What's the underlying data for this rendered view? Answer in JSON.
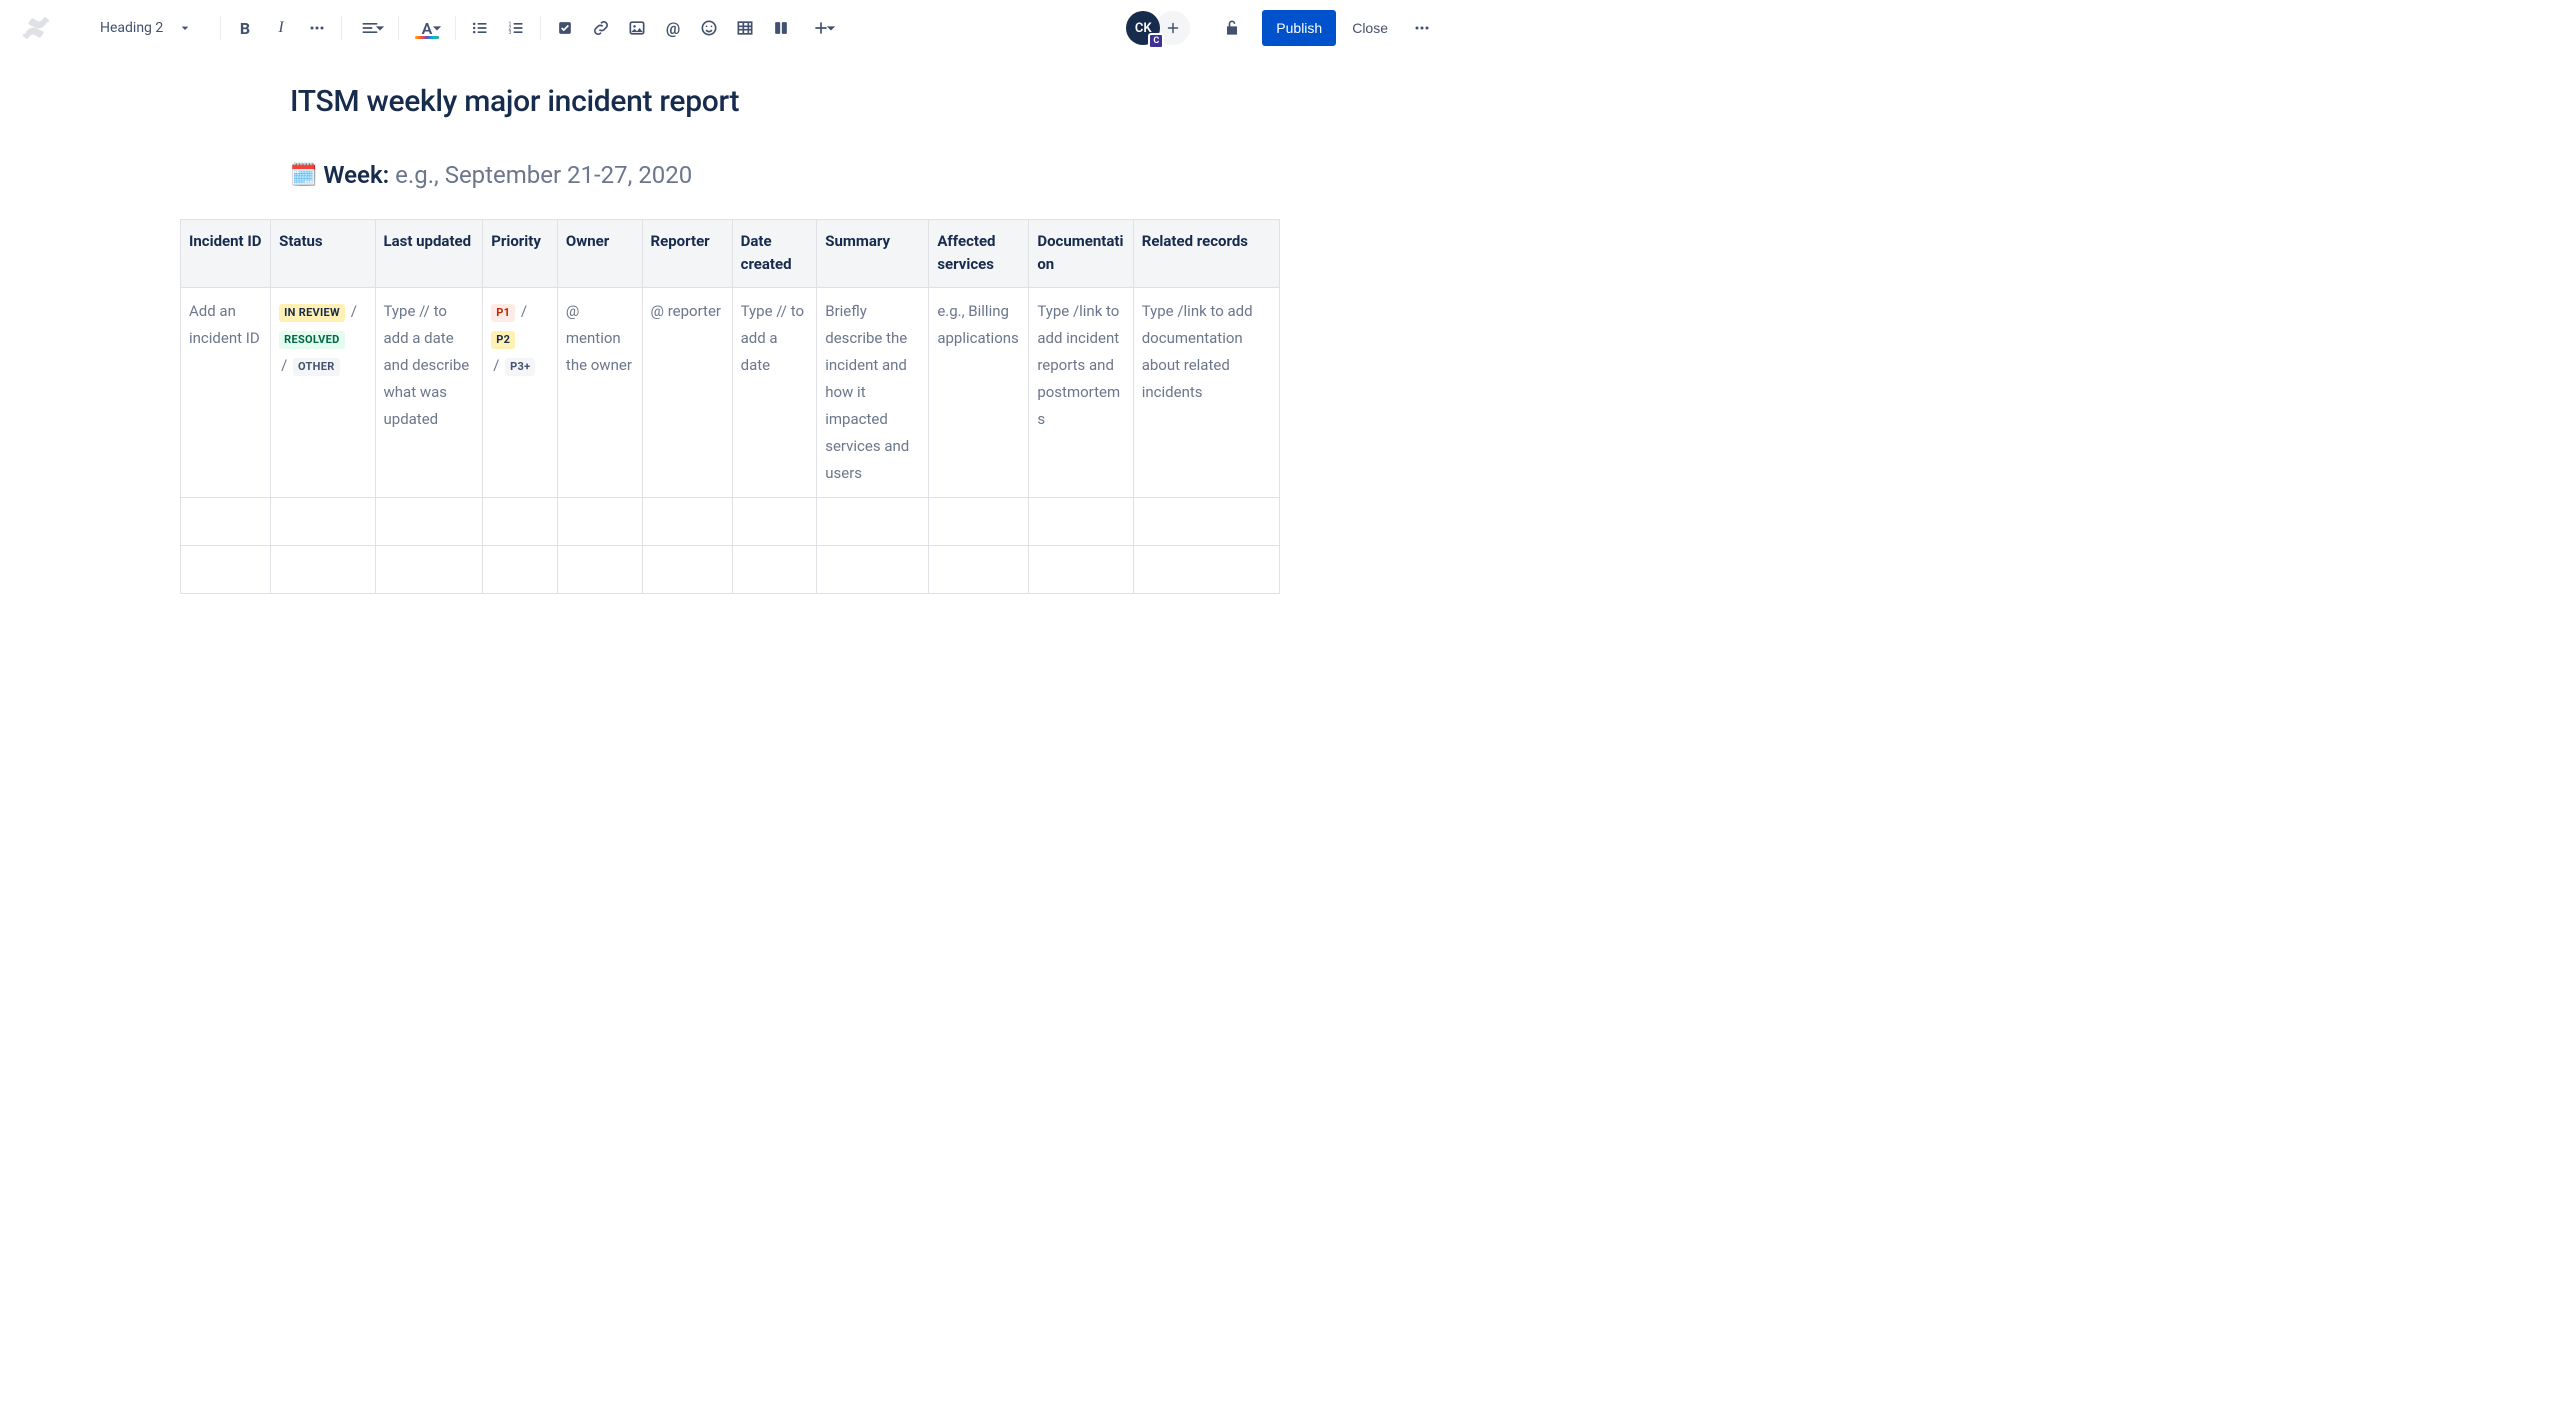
{
  "toolbar": {
    "style_label": "Heading 2",
    "avatar_initials": "CK",
    "avatar_badge": "C",
    "publish_label": "Publish",
    "close_label": "Close"
  },
  "page": {
    "title": "ITSM weekly major incident report",
    "week_label": "Week:",
    "week_placeholder": "e.g., September 21-27, 2020"
  },
  "table": {
    "headers": {
      "incident_id": "Incident ID",
      "status": "Status",
      "last_updated": "Last updated",
      "priority": "Priority",
      "owner": "Owner",
      "reporter": "Reporter",
      "date_created": "Date created",
      "summary": "Summary",
      "affected": "Affected services",
      "documentation": "Documentation",
      "related": "Related records"
    },
    "row1": {
      "incident_id": "Add an incident ID",
      "status_badges": {
        "in_review": "IN REVIEW",
        "resolved": "RESOLVED",
        "other": "OTHER"
      },
      "last_updated": "Type // to add a date and describe what was updated",
      "priority_badges": {
        "p1": "P1",
        "p2": "P2",
        "p3": "P3+"
      },
      "owner": "@ mention the owner",
      "reporter": "@ reporter",
      "date_created": "Type // to add a date",
      "summary": "Briefly describe the incident and how it impacted services and users",
      "affected": "e.g., Billing applications",
      "documentation": "Type /link to add incident reports and postmortems",
      "related": "Type /link to add documentation about related incidents"
    }
  }
}
